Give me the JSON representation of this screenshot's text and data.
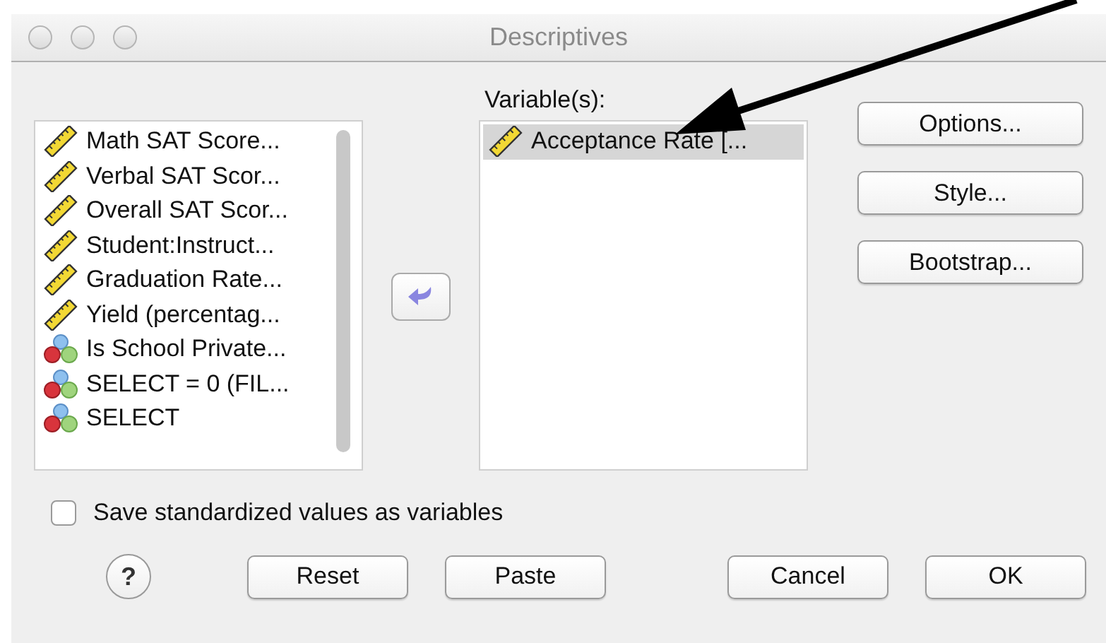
{
  "window": {
    "title": "Descriptives"
  },
  "source_list": {
    "items": [
      {
        "label": "Math SAT Score...",
        "kind": "scale",
        "selected": false
      },
      {
        "label": "Verbal SAT Scor...",
        "kind": "scale",
        "selected": false
      },
      {
        "label": "Overall SAT Scor...",
        "kind": "scale",
        "selected": false
      },
      {
        "label": "Student:Instruct...",
        "kind": "scale",
        "selected": false
      },
      {
        "label": "Graduation Rate...",
        "kind": "scale",
        "selected": false
      },
      {
        "label": "Yield (percentag...",
        "kind": "scale",
        "selected": false
      },
      {
        "label": "Is School Private...",
        "kind": "nominal",
        "selected": false
      },
      {
        "label": "SELECT = 0 (FIL...",
        "kind": "nominal",
        "selected": false
      },
      {
        "label": "SELECT",
        "kind": "nominal",
        "selected": false
      }
    ]
  },
  "target_list": {
    "label": "Variable(s):",
    "items": [
      {
        "label": "Acceptance Rate [...",
        "kind": "scale",
        "selected": true
      }
    ]
  },
  "side_buttons": [
    "Options...",
    "Style...",
    "Bootstrap..."
  ],
  "save_checkbox": {
    "label": "Save standardized values as variables",
    "checked": false
  },
  "help_button": {
    "label": "?"
  },
  "bottom_buttons": [
    "Reset",
    "Paste",
    "Cancel",
    "OK"
  ]
}
